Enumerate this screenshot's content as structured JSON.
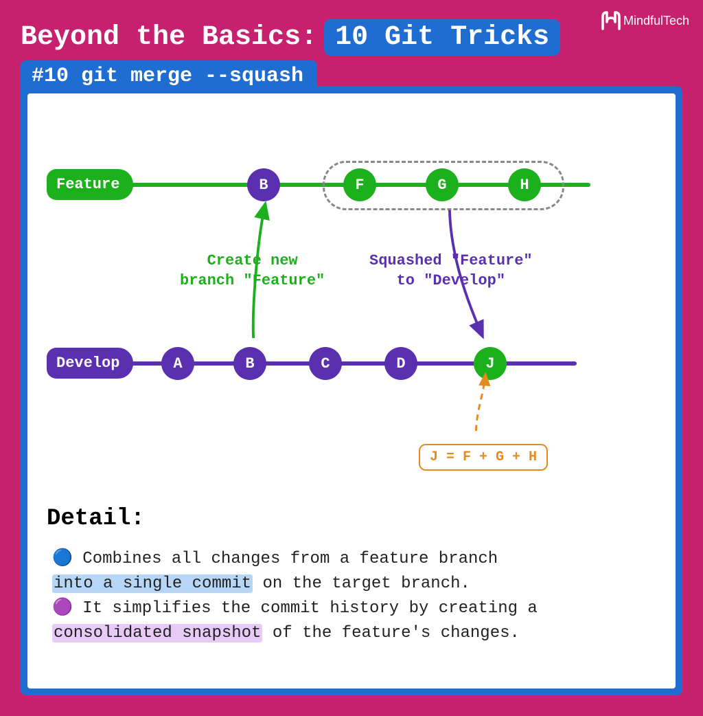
{
  "brand": "MindfulTech",
  "title_prefix": "Beyond the Basics:",
  "title_badge": "10 Git Tricks",
  "tab": "#10 git merge --squash",
  "colors": {
    "bg": "#c5216e",
    "blue": "#1f6dd0",
    "purple": "#5a2fb0",
    "green": "#1cb01c",
    "orange": "#e58a1f"
  },
  "diagram": {
    "feature": {
      "label": "Feature",
      "commits": [
        "B",
        "F",
        "G",
        "H"
      ]
    },
    "develop": {
      "label": "Develop",
      "commits": [
        "A",
        "B",
        "C",
        "D",
        "J"
      ]
    },
    "annot_create": "Create new\nbranch \"Feature\"",
    "annot_squash": "Squashed \"Feature\"\nto \"Develop\"",
    "equation": "J = F + G + H"
  },
  "detail": {
    "heading": "Detail:",
    "line1_pre": " Combines all changes from a feature branch ",
    "line1_hl": "into a single commit",
    "line1_post": " on the target branch.",
    "line2_pre": " It simplifies the commit history by creating a ",
    "line2_hl": "consolidated snapshot",
    "line2_post": " of the feature's changes."
  }
}
